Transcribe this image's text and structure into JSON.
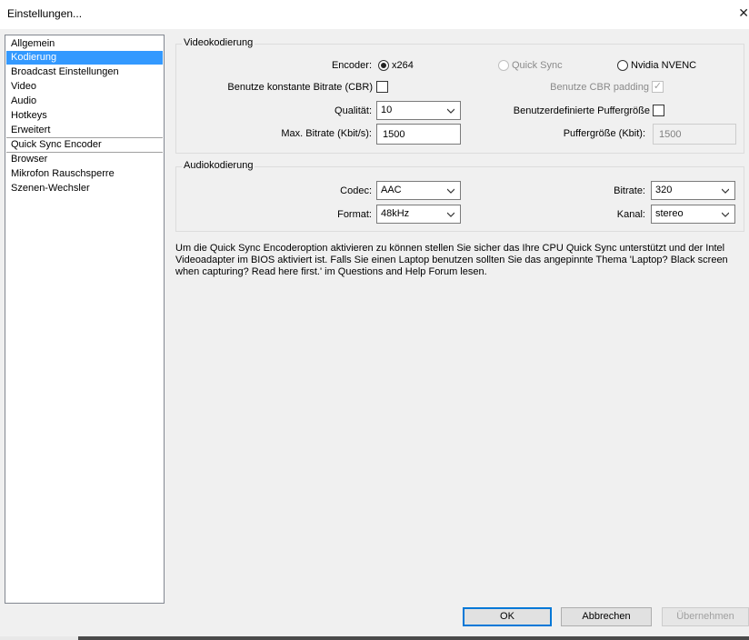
{
  "window": {
    "title": "Einstellungen...",
    "close_icon": "close-icon"
  },
  "nav": {
    "items": [
      {
        "label": "Allgemein"
      },
      {
        "label": "Kodierung",
        "selected": true
      },
      {
        "label": "Broadcast Einstellungen"
      },
      {
        "label": "Video"
      },
      {
        "label": "Audio"
      },
      {
        "label": "Hotkeys"
      },
      {
        "label": "Erweitert"
      },
      {
        "label": "Quick Sync Encoder"
      },
      {
        "label": "Browser"
      },
      {
        "label": "Mikrofon Rauschsperre"
      },
      {
        "label": "Szenen-Wechsler"
      }
    ]
  },
  "video": {
    "group_title": "Videokodierung",
    "encoder_label": "Encoder:",
    "encoder_options": [
      {
        "label": "x264",
        "checked": true,
        "enabled": true
      },
      {
        "label": "Quick Sync",
        "checked": false,
        "enabled": false
      },
      {
        "label": "Nvidia NVENC",
        "checked": false,
        "enabled": true
      }
    ],
    "cbr_label": "Benutze konstante Bitrate (CBR)",
    "cbr_checked": false,
    "cbr_padding_label": "Benutze CBR padding",
    "cbr_padding_checked": true,
    "quality_label": "Qualität:",
    "quality_value": "10",
    "custom_buffer_label": "Benutzerdefinierte Puffergröße",
    "custom_buffer_checked": false,
    "max_bitrate_label": "Max. Bitrate (Kbit/s):",
    "max_bitrate_value": "1500",
    "buffer_size_label": "Puffergröße (Kbit):",
    "buffer_size_value": "1500"
  },
  "audio": {
    "group_title": "Audiokodierung",
    "codec_label": "Codec:",
    "codec_value": "AAC",
    "bitrate_label": "Bitrate:",
    "bitrate_value": "320",
    "format_label": "Format:",
    "format_value": "48kHz",
    "channel_label": "Kanal:",
    "channel_value": "stereo"
  },
  "info_text": "Um die Quick Sync Encoderoption aktivieren zu können stellen Sie sicher das Ihre CPU Quick Sync unterstützt und der Intel Videoadapter im BIOS aktiviert ist. Falls Sie einen Laptop benutzen sollten Sie das angepinnte Thema 'Laptop? Black screen when capturing? Read here first.' im Questions and Help Forum lesen.",
  "buttons": {
    "ok": "OK",
    "cancel": "Abbrechen",
    "apply": "Übernehmen"
  }
}
